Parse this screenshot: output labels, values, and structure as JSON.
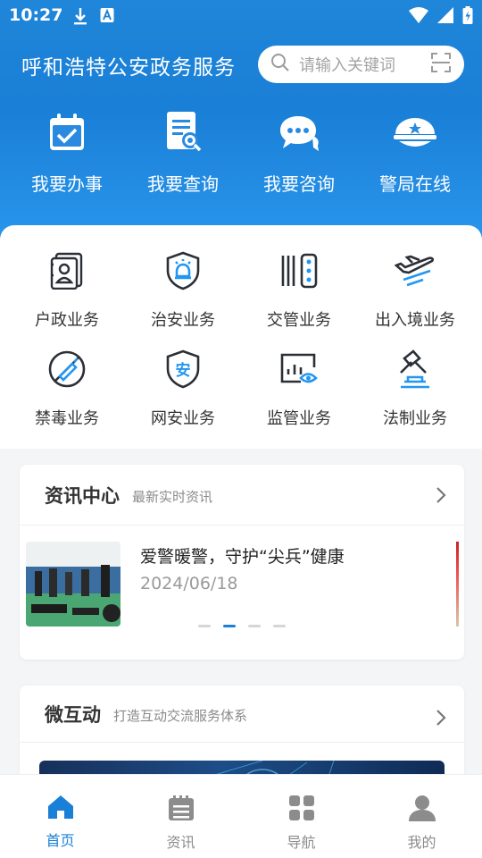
{
  "status": {
    "time": "10:27"
  },
  "header": {
    "title": "呼和浩特公安政务服务",
    "search_placeholder": "请输入关键词"
  },
  "quick_actions": [
    {
      "label": "我要办事",
      "icon": "checklist-clipboard-icon"
    },
    {
      "label": "我要查询",
      "icon": "document-search-icon"
    },
    {
      "label": "我要咨询",
      "icon": "chat-bubbles-icon"
    },
    {
      "label": "警局在线",
      "icon": "police-cap-icon"
    }
  ],
  "business": [
    {
      "label": "户政业务",
      "icon": "id-card-icon"
    },
    {
      "label": "治安业务",
      "icon": "shield-alarm-icon"
    },
    {
      "label": "交管业务",
      "icon": "traffic-light-icon"
    },
    {
      "label": "出入境业务",
      "icon": "airplane-icon"
    },
    {
      "label": "禁毒业务",
      "icon": "no-drugs-icon"
    },
    {
      "label": "网安业务",
      "icon": "cyber-shield-icon"
    },
    {
      "label": "监管业务",
      "icon": "monitor-eye-icon"
    },
    {
      "label": "法制业务",
      "icon": "gavel-icon"
    }
  ],
  "news_card": {
    "title": "资讯中心",
    "subtitle": "最新实时资讯",
    "item": {
      "title": "爱警暖警，守护“尖兵”健康",
      "date": "2024/06/18"
    },
    "carousel_total": 4,
    "carousel_active": 2
  },
  "interact_card": {
    "title": "微互动",
    "subtitle": "打造互动交流服务体系"
  },
  "tabbar": [
    {
      "label": "首页",
      "icon": "home-icon",
      "active": true
    },
    {
      "label": "资讯",
      "icon": "news-icon",
      "active": false
    },
    {
      "label": "导航",
      "icon": "grid-icon",
      "active": false
    },
    {
      "label": "我的",
      "icon": "user-icon",
      "active": false
    }
  ],
  "colors": {
    "primary": "#1a7fd6",
    "icon_dark": "#2b2f36",
    "icon_accent": "#2196f3"
  }
}
